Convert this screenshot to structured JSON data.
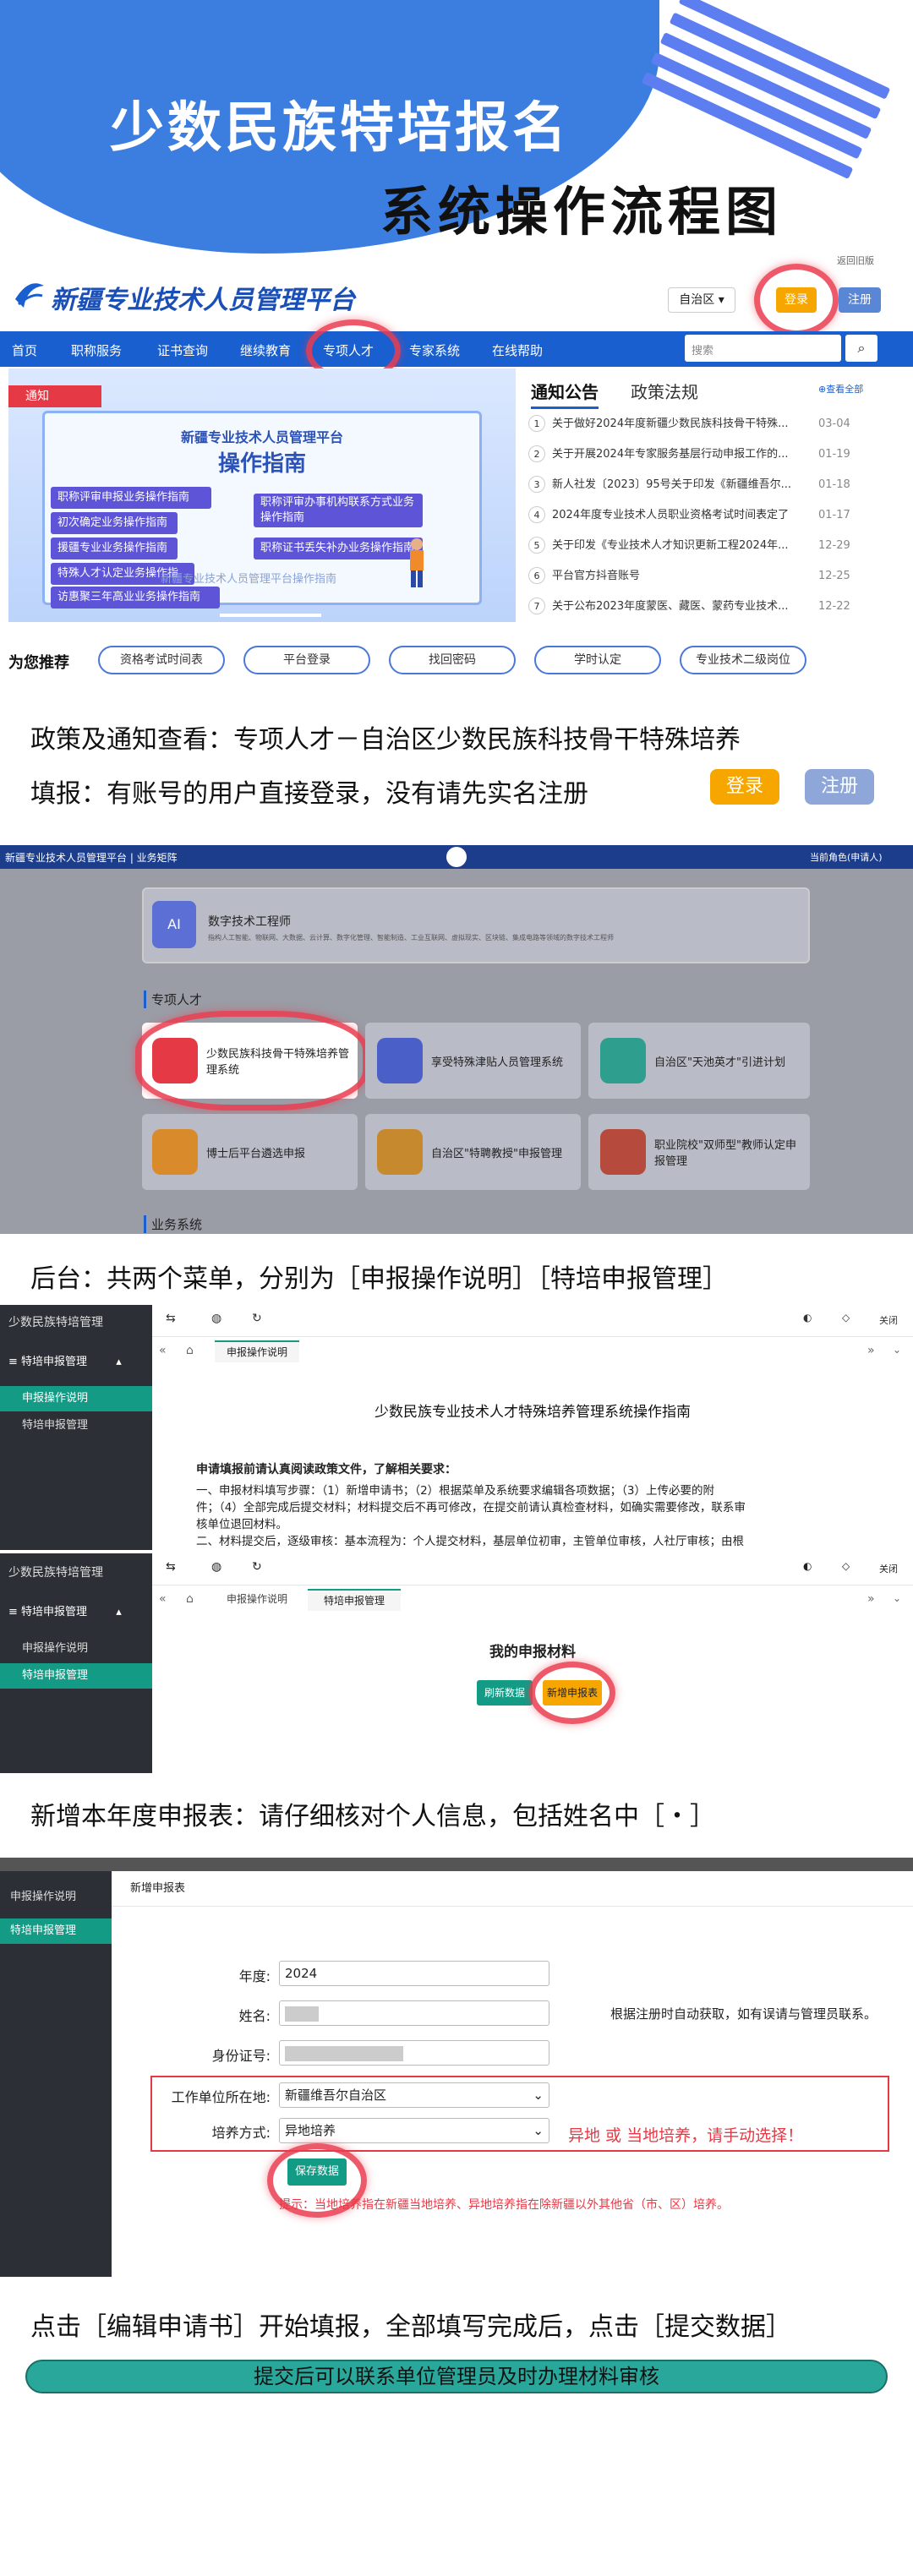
{
  "hero": {
    "title_line1": "少数民族特培报名",
    "title_line2": "系统操作流程图"
  },
  "portal": {
    "top_link": "返回旧版",
    "logo_text": "新疆专业技术人员管理平台",
    "region": "自治区 ▾",
    "login": "登录",
    "register": "注册",
    "nav": [
      "首页",
      "职称服务",
      "证书查询",
      "继续教育",
      "专项人才",
      "专家系统",
      "在线帮助"
    ],
    "search_placeholder": "搜索",
    "banner": {
      "tag": "通知",
      "subtitle": "新疆专业技术人员管理平台",
      "title": "操作指南",
      "watermark": "新疆专业技术人员管理平台操作指南",
      "tiles_left": [
        "职称评审申报业务操作指南",
        "初次确定业务操作指南",
        "援疆专业业务操作指南",
        "特殊人才认定业务操作指南",
        "访惠聚三年高业业务操作指南"
      ],
      "tiles_right": [
        "职称评审办事机构联系方式业务操作指南",
        "职称证书丢失补办业务操作指南"
      ]
    },
    "notice_tabs": [
      "通知公告",
      "政策法规"
    ],
    "view_all": "查看全部",
    "notices": [
      {
        "n": "1",
        "title": "关于做好2024年度新疆少数民族科技骨干特殊...",
        "date": "03-04"
      },
      {
        "n": "2",
        "title": "关于开展2024年专家服务基层行动申报工作的...",
        "date": "01-19"
      },
      {
        "n": "3",
        "title": "新人社发〔2023〕95号关于印发《新疆维吾尔...",
        "date": "01-18"
      },
      {
        "n": "4",
        "title": "2024年度专业技术人员职业资格考试时间表定了",
        "date": "01-17"
      },
      {
        "n": "5",
        "title": "关于印发《专业技术人才知识更新工程2024年...",
        "date": "12-29"
      },
      {
        "n": "6",
        "title": "平台官方抖音账号",
        "date": "12-25"
      },
      {
        "n": "7",
        "title": "关于公布2023年度蒙医、藏医、蒙药专业技术...",
        "date": "12-22"
      }
    ],
    "rec_label": "为您推荐",
    "rec_items": [
      "资格考试时间表",
      "平台登录",
      "找回密码",
      "学时认定",
      "专业技术二级岗位"
    ]
  },
  "caption1": {
    "line1": "政策及通知查看：专项人才－自治区少数民族科技骨干特殊培养",
    "line2": "填报：有账号的用户直接登录，没有请先实名注册",
    "login": "登录",
    "register": "注册"
  },
  "dashboard": {
    "title": "新疆专业技术人员管理平台 | 业务矩阵",
    "user": "当前角色(申请人)",
    "top_card_title": "数字技术工程师",
    "top_card_desc": "指构人工智能、物联网、大数据、云计算、数字化管理、智能制造、工业互联网、虚拟现实、区块链、集成电路等领域的数字技术工程师",
    "ai_badge": "AI",
    "section_label": "专项人才",
    "tiles": [
      {
        "name": "少数民族科技骨干特殊培养管理系统"
      },
      {
        "name": "享受特殊津贴人员管理系统"
      },
      {
        "name": "自治区\"天池英才\"引进计划"
      },
      {
        "name": "博士后平台遴选申报"
      },
      {
        "name": "自治区\"特聘教授\"申报管理"
      },
      {
        "name": "职业院校\"双师型\"教师认定申报管理"
      }
    ],
    "section_label2": "业务系统"
  },
  "caption2": "后台：共两个菜单，分别为［申报操作说明］［特培申报管理］",
  "admin1": {
    "brand": "少数民族特培管理",
    "menu_group": "特培申报管理",
    "menu_items": [
      "申报操作说明",
      "特培申报管理"
    ],
    "tab": "申报操作说明",
    "close": "关闭",
    "doc_title": "少数民族专业技术人才特殊培养管理系统操作指南",
    "doc_heading": "申请填报前请认真阅读政策文件，了解相关要求：",
    "doc_line1": "一、申报材料填写步骤：（1）新增申请书；（2）根据菜单及系统要求编辑各项数据；（3）上传必要的附",
    "doc_line2": "件；（4）全部完成后提交材料；材料提交后不再可修改，在提交前请认真检查材料，如确实需要修改，联系审",
    "doc_line3": "核单位退回材料。",
    "doc_line4": "二、材料提交后，逐级审核：基本流程为：个人提交材料，基层单位初审，主管单位审核，人社厅审核；由根"
  },
  "admin2": {
    "brand": "少数民族特培管理",
    "menu_group": "特培申报管理",
    "menu_items": [
      "申报操作说明",
      "特培申报管理"
    ],
    "tabs": [
      "申报操作说明",
      "特培申报管理"
    ],
    "close": "关闭",
    "heading": "我的申报材料",
    "refresh": "刷新数据",
    "add": "新增申报表"
  },
  "caption3": "新增本年度申报表：请仔细核对个人信息，包括姓名中［・］",
  "form": {
    "side_items": [
      "申报操作说明",
      "特培申报管理"
    ],
    "tab": "新增申报表",
    "year_label": "年度:",
    "year": "2024",
    "name_label": "姓名:",
    "name": "",
    "id_label": "身份证号:",
    "id": "",
    "auto_note": "根据注册时自动获取，如有误请与管理员联系。",
    "unit_label": "工作单位所在地:",
    "unit": "新疆维吾尔自治区",
    "mode_label": "培养方式:",
    "mode": "异地培养",
    "choose_note": "异地  或  当地培养，请手动选择！",
    "save": "保存数据",
    "tip": "提示：当地培养指在新疆当地培养、异地培养指在除新疆以外其他省（市、区）培养。"
  },
  "caption4": "点击［编辑申请书］开始填报，全部填写完成后，点击［提交数据］",
  "footer_banner": "提交后可以联系单位管理员及时办理材料审核",
  "colors": {
    "primary": "#1a5fd0",
    "orange": "#f7a600",
    "teal": "#139b86",
    "red": "#e53945"
  }
}
